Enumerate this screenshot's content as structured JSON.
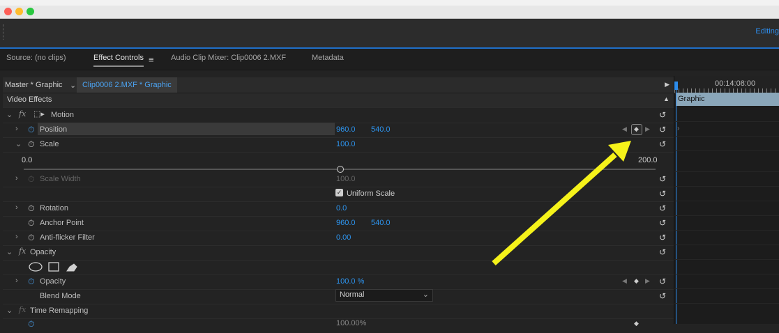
{
  "toolbar": {
    "workspace": "Editing"
  },
  "tabs": [
    "Source: (no clips)",
    "Effect Controls",
    "Audio Clip Mixer: Clip0006 2.MXF",
    "Metadata"
  ],
  "header": {
    "master": "Master * Graphic",
    "clip": "Clip0006 2.MXF * Graphic"
  },
  "video_effects": "Video Effects",
  "motion": {
    "label": "Motion",
    "position": {
      "label": "Position",
      "x": "960.0",
      "y": "540.0"
    },
    "scale": {
      "label": "Scale",
      "value": "100.0",
      "min": "0.0",
      "max": "200.0"
    },
    "scale_width": {
      "label": "Scale Width",
      "value": "100.0"
    },
    "uniform_scale": "Uniform Scale",
    "rotation": {
      "label": "Rotation",
      "value": "0.0"
    },
    "anchor": {
      "label": "Anchor Point",
      "x": "960.0",
      "y": "540.0"
    },
    "antiflicker": {
      "label": "Anti-flicker Filter",
      "value": "0.00"
    }
  },
  "opacity": {
    "group_label": "Opacity",
    "label": "Opacity",
    "value": "100.0 %",
    "blend_label": "Blend Mode",
    "blend_value": "Normal"
  },
  "time_remapping": {
    "label": "Time Remapping",
    "speed_partial": "100.00%"
  },
  "timeline": {
    "timecode": "00:14:08:00",
    "clip_label": "Graphic"
  },
  "colors": {
    "accent": "#2d95f0",
    "annotation_arrow": "#f5f21a"
  },
  "icons": [
    "fx-icon",
    "stopwatch-icon",
    "reset-icon",
    "ellipse-mask-icon",
    "rectangle-mask-icon",
    "pen-mask-icon",
    "keyframe-icon"
  ]
}
